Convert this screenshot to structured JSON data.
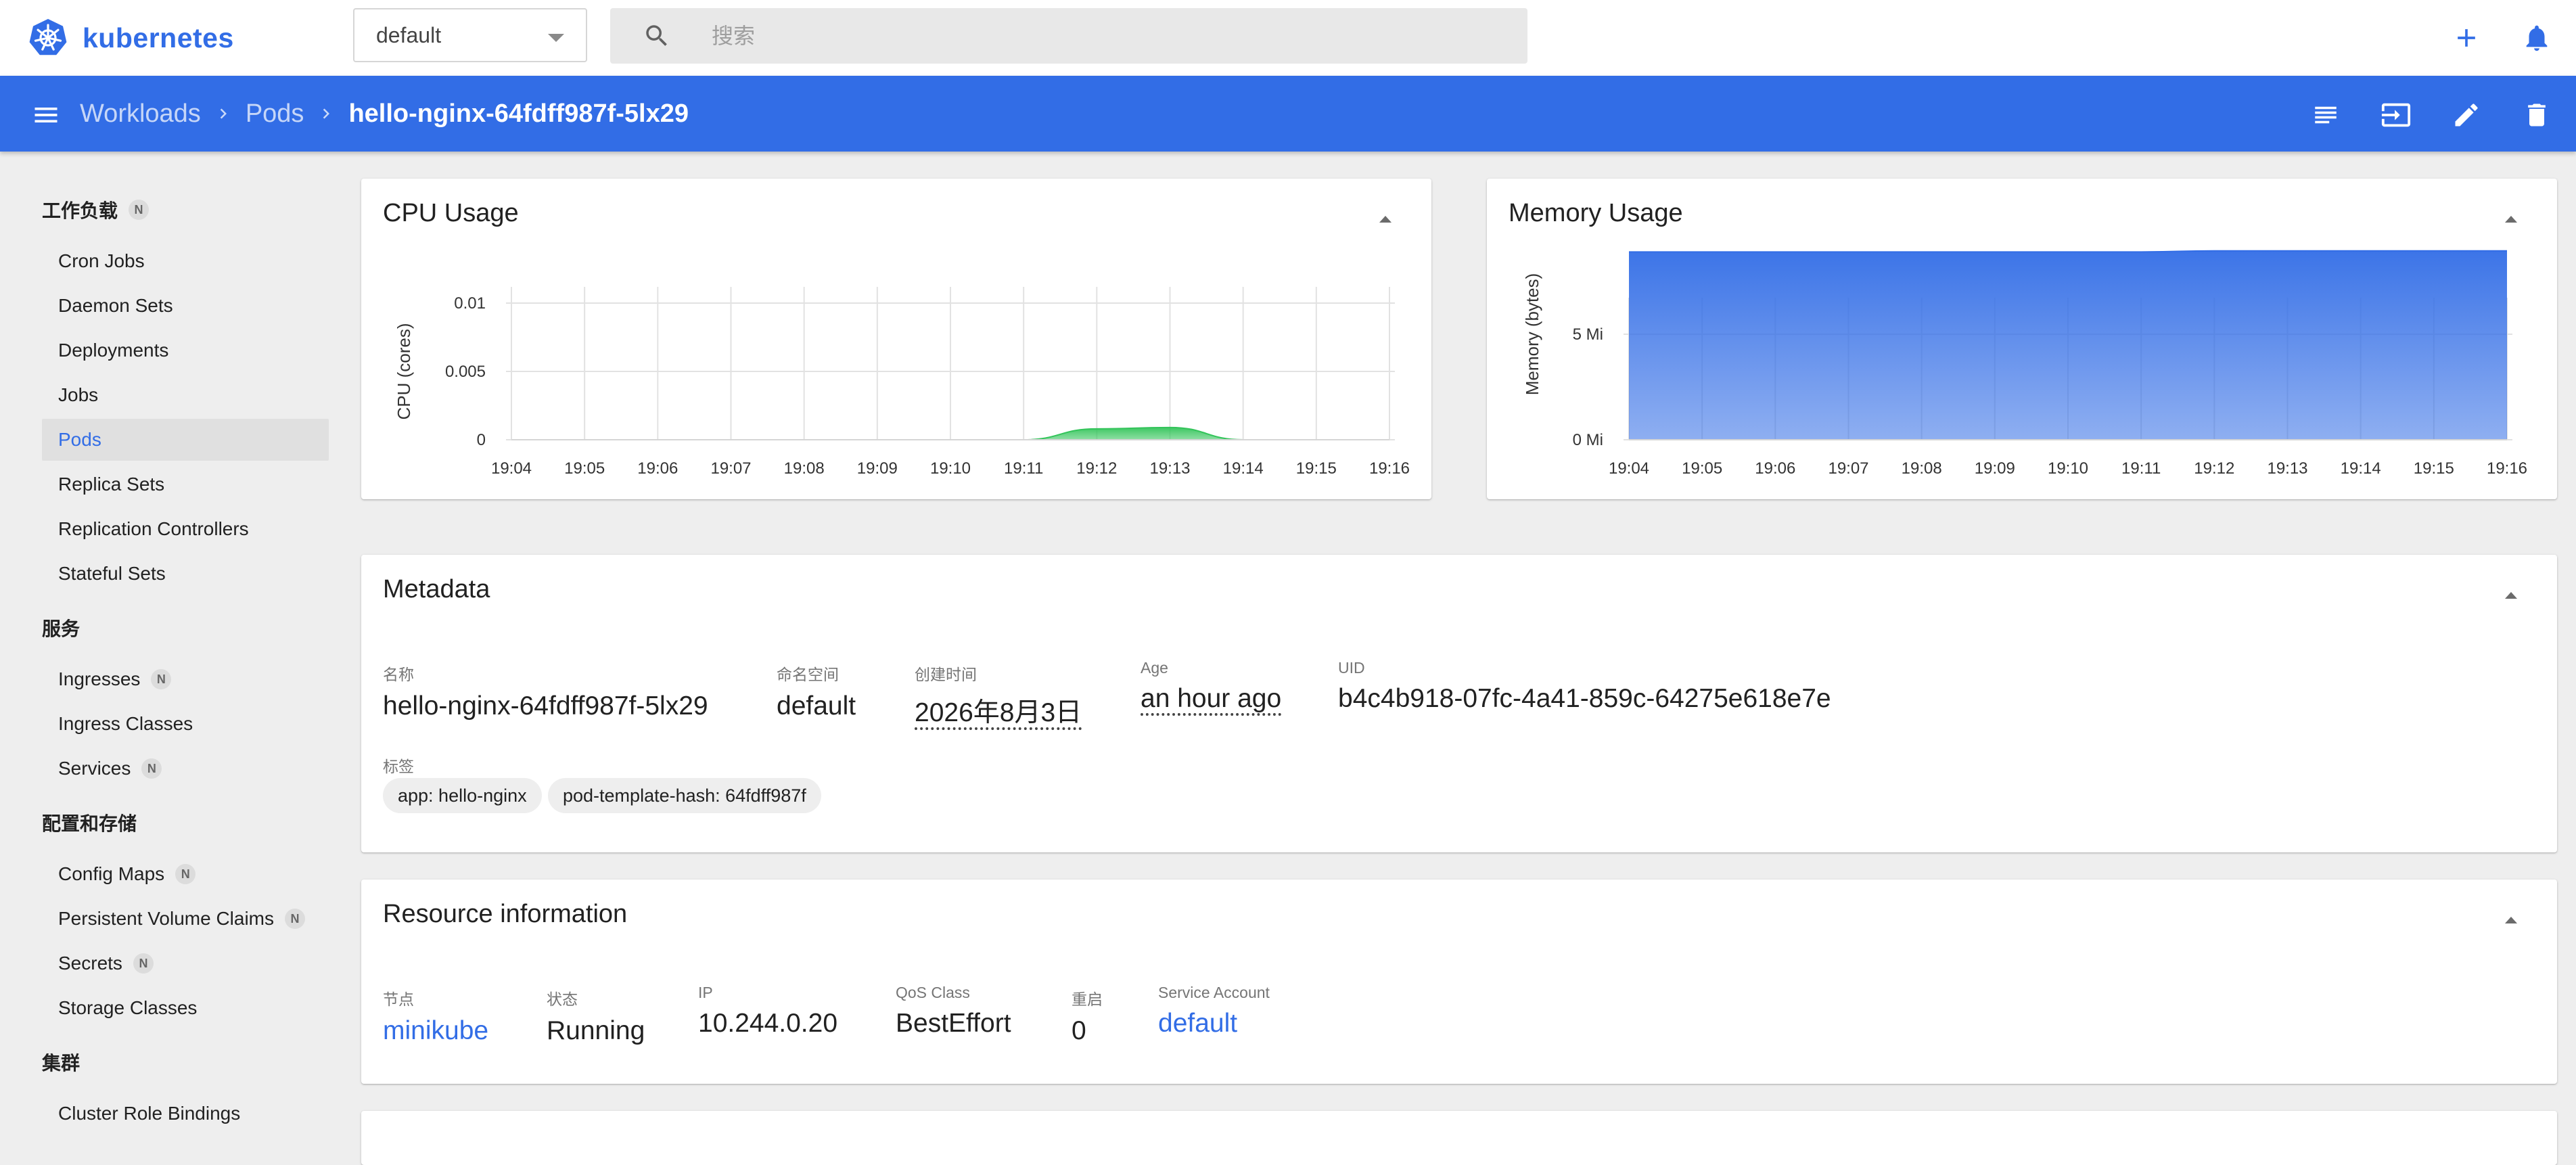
{
  "app": {
    "name": "kubernetes"
  },
  "namespace_selector": {
    "value": "default"
  },
  "search": {
    "placeholder": "搜索"
  },
  "breadcrumb": {
    "items": [
      "Workloads",
      "Pods"
    ],
    "current": "hello-nginx-64fdff987f-5lx29"
  },
  "sidebar": {
    "sections": [
      {
        "title": "工作负载",
        "badge": "N",
        "items": [
          {
            "label": "Cron Jobs"
          },
          {
            "label": "Daemon Sets"
          },
          {
            "label": "Deployments"
          },
          {
            "label": "Jobs"
          },
          {
            "label": "Pods",
            "active": true
          },
          {
            "label": "Replica Sets"
          },
          {
            "label": "Replication Controllers"
          },
          {
            "label": "Stateful Sets"
          }
        ]
      },
      {
        "title": "服务",
        "items": [
          {
            "label": "Ingresses",
            "badge": "N"
          },
          {
            "label": "Ingress Classes"
          },
          {
            "label": "Services",
            "badge": "N"
          }
        ]
      },
      {
        "title": "配置和存储",
        "items": [
          {
            "label": "Config Maps",
            "badge": "N"
          },
          {
            "label": "Persistent Volume Claims",
            "badge": "N"
          },
          {
            "label": "Secrets",
            "badge": "N"
          },
          {
            "label": "Storage Classes"
          }
        ]
      },
      {
        "title": "集群",
        "items": [
          {
            "label": "Cluster Role Bindings"
          }
        ]
      }
    ]
  },
  "cpu_card": {
    "title": "CPU Usage"
  },
  "memory_card": {
    "title": "Memory Usage"
  },
  "chart_data": [
    {
      "type": "area",
      "title": "CPU Usage",
      "ylabel": "CPU (cores)",
      "x": [
        "19:04",
        "19:05",
        "19:06",
        "19:07",
        "19:08",
        "19:09",
        "19:10",
        "19:11",
        "19:12",
        "19:13",
        "19:14",
        "19:15",
        "19:16"
      ],
      "yticks": [
        "0",
        "0.005",
        "0.01"
      ],
      "ylim": [
        0,
        0.01
      ],
      "series": [
        {
          "values": [
            0,
            0,
            0,
            0,
            0,
            0,
            0,
            0,
            0.0008,
            0.0009,
            0,
            0,
            0
          ]
        }
      ],
      "color": "#33c45a",
      "grid": true
    },
    {
      "type": "area",
      "title": "Memory Usage",
      "ylabel": "Memory (bytes)",
      "x": [
        "19:04",
        "19:05",
        "19:06",
        "19:07",
        "19:08",
        "19:09",
        "19:10",
        "19:11",
        "19:12",
        "19:13",
        "19:14",
        "19:15",
        "19:16"
      ],
      "yticks": [
        "0 Mi",
        "5 Mi"
      ],
      "ylim": [
        0,
        10
      ],
      "series": [
        {
          "values": [
            8.9,
            8.9,
            8.9,
            8.9,
            8.9,
            8.9,
            8.9,
            8.9,
            8.95,
            8.95,
            8.95,
            8.95,
            8.95
          ]
        }
      ],
      "color": "#326de6",
      "grid": true
    }
  ],
  "metadata": {
    "title": "Metadata",
    "fields": [
      {
        "label": "名称",
        "value": "hello-nginx-64fdff987f-5lx29"
      },
      {
        "label": "命名空间",
        "value": "default"
      },
      {
        "label": "创建时间",
        "value": "2026年8月3日"
      },
      {
        "label": "Age",
        "value": "an hour ago"
      },
      {
        "label": "UID",
        "value": "b4c4b918-07fc-4a41-859c-64275e618e7e"
      }
    ],
    "labels_title": "标签",
    "labels": [
      "app: hello-nginx",
      "pod-template-hash: 64fdff987f"
    ]
  },
  "resource": {
    "title": "Resource information",
    "fields": [
      {
        "label": "节点",
        "value": "minikube"
      },
      {
        "label": "状态",
        "value": "Running"
      },
      {
        "label": "IP",
        "value": "10.244.0.20"
      },
      {
        "label": "QoS Class",
        "value": "BestEffort"
      },
      {
        "label": "重启",
        "value": "0"
      },
      {
        "label": "Service Account",
        "value": "default"
      }
    ]
  },
  "colors": {
    "primary": "#326de6",
    "cpu_fill": "#33c45a",
    "memory_fill": "#326de6"
  }
}
